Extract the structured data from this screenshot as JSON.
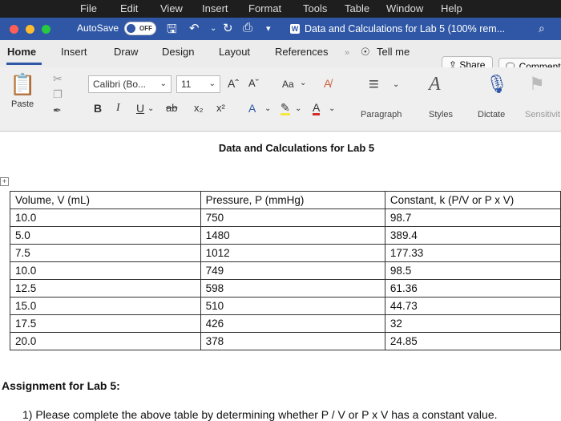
{
  "menubar": {
    "items": [
      "File",
      "Edit",
      "View",
      "Insert",
      "Format",
      "Tools",
      "Table",
      "Window",
      "Help"
    ]
  },
  "titlebar": {
    "autosave_label": "AutoSave",
    "autosave_state": "OFF",
    "document_title": "Data and Calculations for Lab 5 (100% rem...",
    "doc_badge": "W"
  },
  "ribbon_tabs": {
    "tabs": [
      "Home",
      "Insert",
      "Draw",
      "Design",
      "Layout",
      "References"
    ],
    "active": "Home",
    "tell_me": "Tell me",
    "share": "Share",
    "comment": "Comment"
  },
  "ribbon": {
    "paste_label": "Paste",
    "font_name": "Calibri (Bo...",
    "font_size": "11",
    "grow_font": "Aˆ",
    "shrink_font": "Aˇ",
    "change_case": "Aa",
    "bold": "B",
    "italic": "I",
    "underline": "U",
    "strikethrough": "ab",
    "subscript": "x₂",
    "superscript": "x²",
    "text_effects": "A",
    "font_color": "A",
    "paragraph_label": "Paragraph",
    "styles_label": "Styles",
    "dictate_label": "Dictate",
    "sensitivity_label": "Sensitivit",
    "colors": {
      "highlight": "#f5e642",
      "font_color": "#d62b2b",
      "accent": "#2f57a6"
    }
  },
  "document": {
    "heading": "Data and Calculations for Lab 5",
    "table_handle": "+",
    "table": {
      "headers": [
        "Volume, V (mL)",
        "Pressure, P (mmHg)",
        "Constant, k (P/V or P x V)"
      ],
      "rows": [
        [
          "10.0",
          "750",
          "98.7"
        ],
        [
          "5.0",
          "1480",
          "389.4"
        ],
        [
          "7.5",
          "1012",
          "177.33"
        ],
        [
          "10.0",
          "749",
          "98.5"
        ],
        [
          "12.5",
          "598",
          "61.36"
        ],
        [
          "15.0",
          "510",
          "44.73"
        ],
        [
          "17.5",
          "426",
          "32"
        ],
        [
          "20.0",
          "378",
          "24.85"
        ]
      ]
    },
    "assignment_title": "Assignment for Lab 5:",
    "assignment_items": [
      "1)  Please complete the above table by determining whether P / V or P x V has a constant value."
    ]
  }
}
